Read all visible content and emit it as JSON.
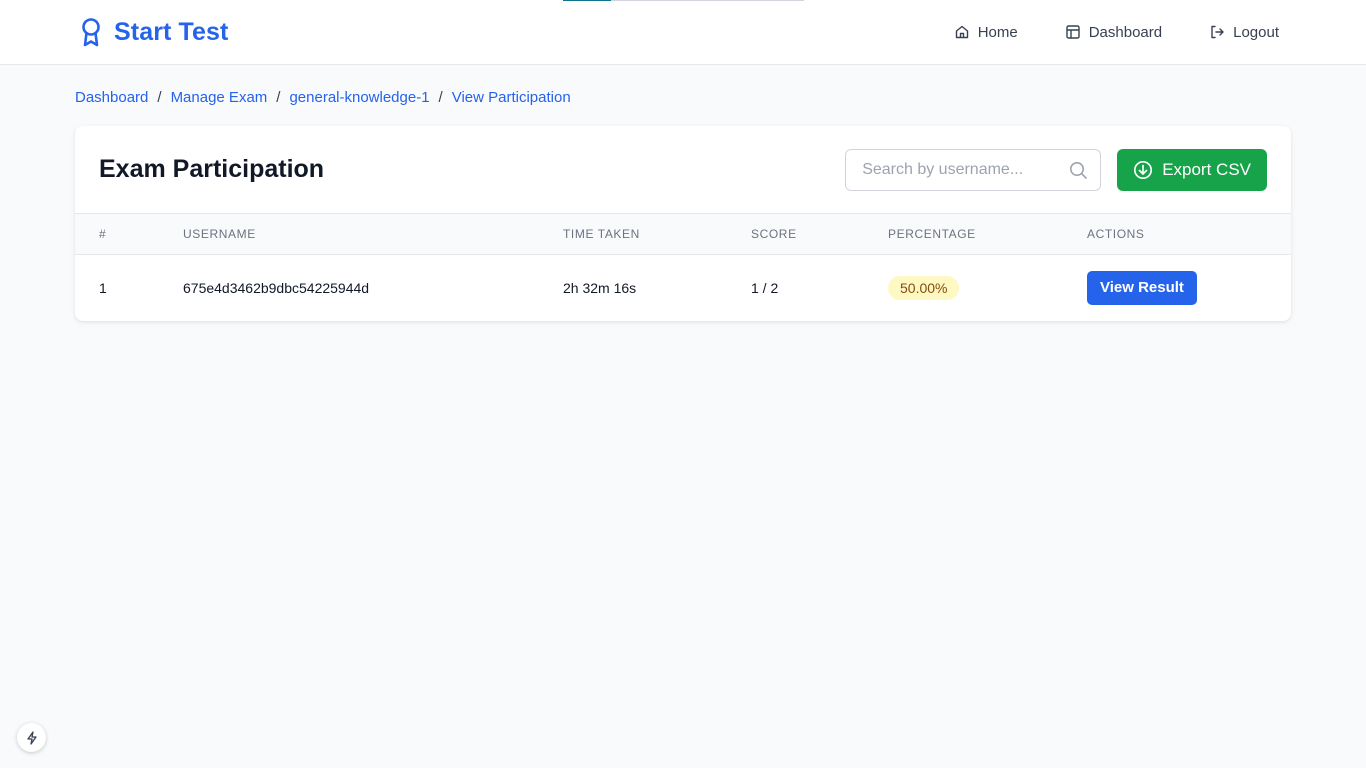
{
  "header": {
    "brand_title": "Start Test",
    "nav": [
      {
        "label": "Home",
        "icon": "home-icon"
      },
      {
        "label": "Dashboard",
        "icon": "layout-icon"
      },
      {
        "label": "Logout",
        "icon": "logout-icon"
      }
    ]
  },
  "breadcrumb": [
    "Dashboard",
    "Manage Exam",
    "general-knowledge-1",
    "View Participation"
  ],
  "page": {
    "title": "Exam Participation",
    "search_placeholder": "Search by username...",
    "export_label": "Export CSV"
  },
  "table": {
    "columns": [
      "#",
      "USERNAME",
      "TIME TAKEN",
      "SCORE",
      "PERCENTAGE",
      "ACTIONS"
    ],
    "rows": [
      {
        "index": "1",
        "username": "675e4d3462b9dbc54225944d",
        "time_taken": "2h 32m 16s",
        "score": "1 / 2",
        "percentage": "50.00%",
        "action_label": "View Result"
      }
    ]
  },
  "colors": {
    "brand": "#2563eb",
    "export": "#16a34a",
    "badge_bg": "#fef9c3",
    "badge_text": "#854d0e"
  }
}
